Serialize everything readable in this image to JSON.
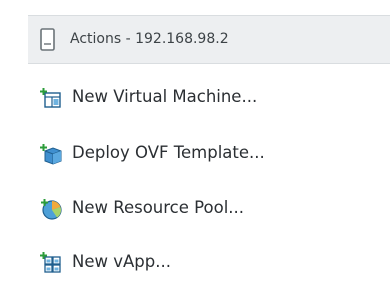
{
  "menu": {
    "header": {
      "title": "Actions - 192.168.98.2",
      "icon": "host-server-icon"
    },
    "items": [
      {
        "label": "New Virtual Machine...",
        "icon": "new-virtual-machine-icon"
      },
      {
        "label": "Deploy OVF Template...",
        "icon": "deploy-ovf-template-icon"
      },
      {
        "label": "New Resource Pool...",
        "icon": "new-resource-pool-icon"
      },
      {
        "label": "New vApp...",
        "icon": "new-vapp-icon"
      }
    ]
  },
  "colors": {
    "header_background": "#edeff1",
    "text": "#2b2f33",
    "accent_blue": "#1a7fc1",
    "accent_green": "#2c9c3a"
  }
}
